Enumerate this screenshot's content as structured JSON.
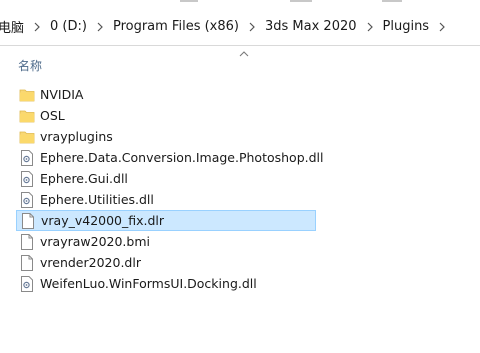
{
  "breadcrumb": {
    "items": [
      {
        "label": "电脑"
      },
      {
        "label": "0 (D:)"
      },
      {
        "label": "Program Files (x86)"
      },
      {
        "label": "3ds Max 2020"
      },
      {
        "label": "Plugins"
      }
    ]
  },
  "columns": {
    "name_label": "名称",
    "sort": "ascending"
  },
  "files": [
    {
      "name": "NVIDIA",
      "type": "folder",
      "icon": "folder-icon"
    },
    {
      "name": "OSL",
      "type": "folder",
      "icon": "folder-icon"
    },
    {
      "name": "vrayplugins",
      "type": "folder",
      "icon": "folder-icon"
    },
    {
      "name": "Ephere.Data.Conversion.Image.Photoshop.dll",
      "type": "dll",
      "icon": "dll-file-icon"
    },
    {
      "name": "Ephere.Gui.dll",
      "type": "dll",
      "icon": "dll-file-icon"
    },
    {
      "name": "Ephere.Utilities.dll",
      "type": "dll",
      "icon": "dll-file-icon"
    },
    {
      "name": "vray_v42000_fix.dlr",
      "type": "file",
      "icon": "blank-file-icon",
      "selected": true
    },
    {
      "name": "vrayraw2020.bmi",
      "type": "file",
      "icon": "blank-file-icon"
    },
    {
      "name": "vrender2020.dlr",
      "type": "file",
      "icon": "blank-file-icon"
    },
    {
      "name": "WeifenLuo.WinFormsUI.Docking.dll",
      "type": "dll",
      "icon": "dll-file-icon"
    }
  ],
  "colors": {
    "folder": "#f8d775",
    "selection_bg": "#cce8ff",
    "selection_border": "#99d1ff",
    "header_text": "#4d6a8a"
  }
}
